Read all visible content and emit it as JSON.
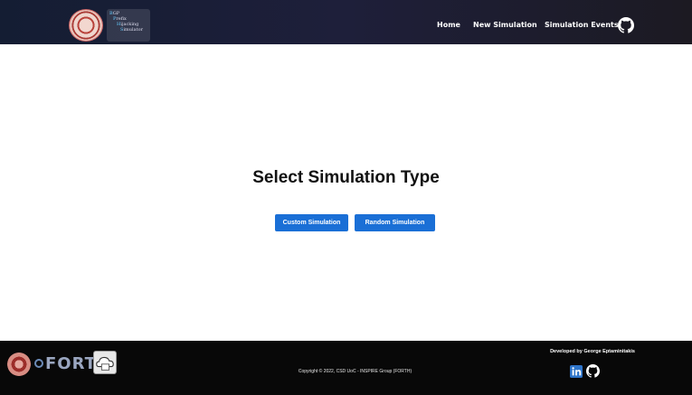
{
  "header": {
    "brand": {
      "logo_icon": "university-seal-icon",
      "lines": [
        {
          "initial": "B",
          "rest": "GP"
        },
        {
          "initial": "P",
          "rest": "refix"
        },
        {
          "initial": "H",
          "rest": "ijacking"
        },
        {
          "initial": "S",
          "rest": "imulator"
        }
      ]
    },
    "nav": {
      "home": "Home",
      "new_simulation": "New Simulation",
      "simulation_events": "Simulation Events",
      "github_icon": "github-icon"
    }
  },
  "main": {
    "title": "Select Simulation Type",
    "buttons": {
      "custom": "Custom Simulation",
      "random": "Random Simulation"
    }
  },
  "footer": {
    "logos": [
      "university-seal-icon",
      "forth-logo-icon",
      "cloud-logo-icon"
    ],
    "forth_text": "FORTH",
    "copyright": "Copyright © 2022, CSD UoC - INSPIRE Group (FORTH)",
    "developer": "Developed by George Eptaminitakis",
    "social_icons": [
      "linkedin-icon",
      "github-icon"
    ]
  },
  "colors": {
    "header_bg": "#1e1f3a",
    "button_bg": "#1a6fd6",
    "footer_bg": "#080808",
    "linkedin": "#2e74c9"
  }
}
